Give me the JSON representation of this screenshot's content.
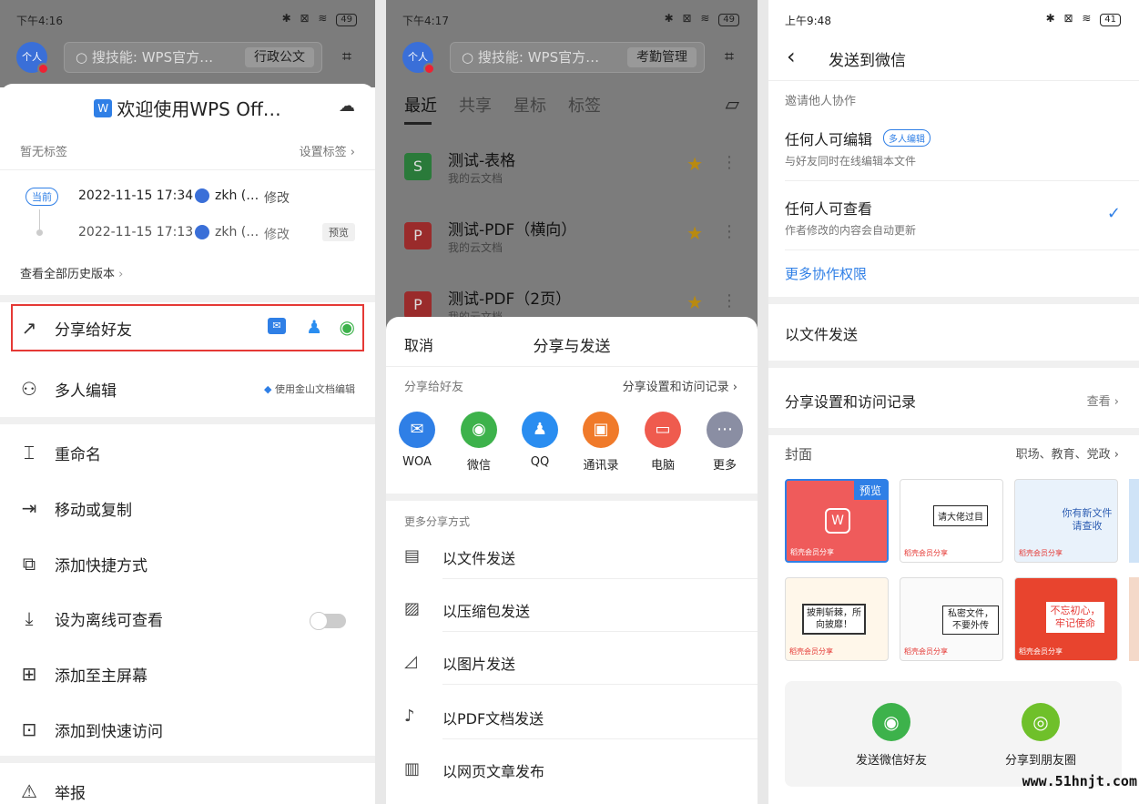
{
  "panel1": {
    "status": {
      "time": "下午4:16",
      "signal": "⊗",
      "battery": "49"
    },
    "avatar": "个人",
    "search_placeholder": "搜技能: WPS官方…",
    "search_chip": "行政公文",
    "title": "欢迎使用WPS Off…",
    "tag_none": "暂无标签",
    "tag_set": "设置标签",
    "history": [
      {
        "badge": "当前",
        "date": "2022-11-15 17:34",
        "user": "zkh (…",
        "action": "修改",
        "extra": ""
      },
      {
        "badge": "",
        "date": "2022-11-15 17:13",
        "user": "zkh (…",
        "action": "修改",
        "extra": "预览"
      }
    ],
    "history_all": "查看全部历史版本",
    "share_friends": "分享给好友",
    "multi_edit": "多人编辑",
    "multi_edit_hint": "使用金山文档编辑",
    "menu": [
      "重命名",
      "移动或复制",
      "添加快捷方式",
      "设为离线可查看",
      "添加至主屏幕",
      "添加到快速访问",
      "举报"
    ]
  },
  "panel2": {
    "status": {
      "time": "下午4:17",
      "signal": "⊗",
      "battery": "49"
    },
    "avatar": "个人",
    "search_placeholder": "搜技能: WPS官方…",
    "search_chip": "考勤管理",
    "tabs": [
      "最近",
      "共享",
      "星标",
      "标签"
    ],
    "files": [
      {
        "name": "测试-表格",
        "loc": "我的云文档",
        "type": "S"
      },
      {
        "name": "测试-PDF（横向）",
        "loc": "我的云文档",
        "type": "P"
      },
      {
        "name": "测试-PDF（2页）",
        "loc": "我的云文档",
        "type": "P"
      }
    ],
    "sheet_cancel": "取消",
    "sheet_title": "分享与发送",
    "share_to": "分享给好友",
    "share_settings": "分享设置和访问记录",
    "apps": [
      {
        "label": "WOA",
        "color": "#2f7fe6",
        "glyph": "✉"
      },
      {
        "label": "微信",
        "color": "#3db24b",
        "glyph": "◉"
      },
      {
        "label": "QQ",
        "color": "#2a8df0",
        "glyph": "♟"
      },
      {
        "label": "通讯录",
        "color": "#f07a2a",
        "glyph": "▣"
      },
      {
        "label": "电脑",
        "color": "#ef5b4e",
        "glyph": "▭"
      },
      {
        "label": "更多",
        "color": "#8a8ea3",
        "glyph": "⋯"
      }
    ],
    "more_ways": "更多分享方式",
    "ways": [
      "以文件发送",
      "以压缩包发送",
      "以图片发送",
      "以PDF文档发送",
      "以网页文章发布"
    ]
  },
  "panel3": {
    "status": {
      "time": "上午9:48",
      "signal": "⊗",
      "battery": "41"
    },
    "title": "发送到微信",
    "invite": "邀请他人协作",
    "opt1_title": "任何人可编辑",
    "opt1_badge": "多人编辑",
    "opt1_desc": "与好友同时在线编辑本文件",
    "opt2_title": "任何人可查看",
    "opt2_desc": "作者修改的内容会自动更新",
    "more_perm": "更多协作权限",
    "send_file": "以文件发送",
    "share_settings": "分享设置和访问记录",
    "view": "查看",
    "cover": "封面",
    "cover_tags": "职场、教育、党政",
    "cover_preview": "预览",
    "covers": [
      "",
      "请大佬过目",
      "你有新文件请查收",
      "披荆斩棘，所向披靡！",
      "私密文件，不要外传",
      "不忘初心，牢记使命"
    ],
    "cover_brand": "稻壳会员分享",
    "send_wechat": "发送微信好友",
    "share_moments": "分享到朋友圈",
    "watermark": "www.51hnjt.com"
  },
  "colors": {
    "accent": "#2f7fe6",
    "highlight": "#e53935",
    "wechat": "#3db24b"
  }
}
